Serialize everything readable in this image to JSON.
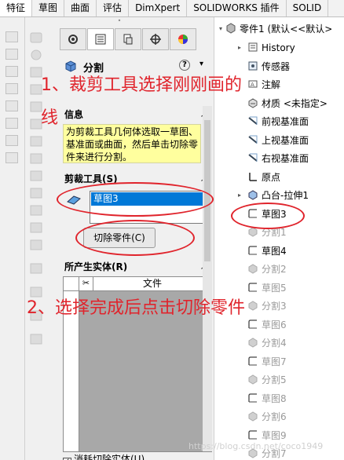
{
  "top_tabs": [
    {
      "label": "特征",
      "active": true
    },
    {
      "label": "草图",
      "active": false
    },
    {
      "label": "曲面",
      "active": false
    },
    {
      "label": "评估",
      "active": false
    },
    {
      "label": "DimXpert",
      "active": false
    },
    {
      "label": "SOLIDWORKS 插件",
      "active": false
    },
    {
      "label": "SOLID",
      "active": false
    }
  ],
  "property_manager": {
    "title": "分割",
    "help_label": "?",
    "messages_title": "信息",
    "message": "为剪裁工具几何体选取一草图、基准面或曲面，然后单击切除零件来进行分割。",
    "trim_tools_title": "剪裁工具(S)",
    "selected_item": "草图3",
    "cut_part_button": "切除零件(C)",
    "resulting_bodies_title": "所产生实体(R)",
    "table_col_file": "文件",
    "consume_cut_bodies_label": "消耗切除实体(U)"
  },
  "feature_tree": {
    "root": "零件1 (默认<<默认>",
    "items": [
      {
        "label": "History",
        "icon": "history-icon",
        "dim": false
      },
      {
        "label": "传感器",
        "icon": "sensor-icon",
        "dim": false
      },
      {
        "label": "注解",
        "icon": "annotation-icon",
        "dim": false
      },
      {
        "label": "材质 <未指定>",
        "icon": "material-icon",
        "dim": false
      },
      {
        "label": "前视基准面",
        "icon": "plane-icon",
        "dim": false
      },
      {
        "label": "上视基准面",
        "icon": "plane-icon",
        "dim": false
      },
      {
        "label": "右视基准面",
        "icon": "plane-icon",
        "dim": false
      },
      {
        "label": "原点",
        "icon": "origin-icon",
        "dim": false
      },
      {
        "label": "凸台-拉伸1",
        "icon": "extrude-icon",
        "dim": false
      },
      {
        "label": "草图3",
        "icon": "sketch-icon",
        "dim": false
      },
      {
        "label": "分割1",
        "icon": "split-icon",
        "dim": true
      },
      {
        "label": "草图4",
        "icon": "sketch-icon",
        "dim": false
      },
      {
        "label": "分割2",
        "icon": "split-icon",
        "dim": true
      },
      {
        "label": "草图5",
        "icon": "sketch-icon",
        "dim": true
      },
      {
        "label": "分割3",
        "icon": "split-icon",
        "dim": true
      },
      {
        "label": "草图6",
        "icon": "sketch-icon",
        "dim": true
      },
      {
        "label": "分割4",
        "icon": "split-icon",
        "dim": true
      },
      {
        "label": "草图7",
        "icon": "sketch-icon",
        "dim": true
      },
      {
        "label": "分割5",
        "icon": "split-icon",
        "dim": true
      },
      {
        "label": "草图8",
        "icon": "sketch-icon",
        "dim": true
      },
      {
        "label": "分割6",
        "icon": "split-icon",
        "dim": true
      },
      {
        "label": "草图9",
        "icon": "sketch-icon",
        "dim": true
      },
      {
        "label": "分割7",
        "icon": "split-icon",
        "dim": true
      }
    ]
  },
  "annotations": {
    "step1_line1": "1、裁剪工具选择刚刚画的",
    "step1_line2": "线",
    "step2": "2、选择完成后点击切除零件"
  },
  "watermark": "https://blog.csdn.net/coco1949",
  "colors": {
    "annotation_red": "#e0242c",
    "selection_blue": "#0078d7",
    "message_yellow": "#ffff9e"
  }
}
